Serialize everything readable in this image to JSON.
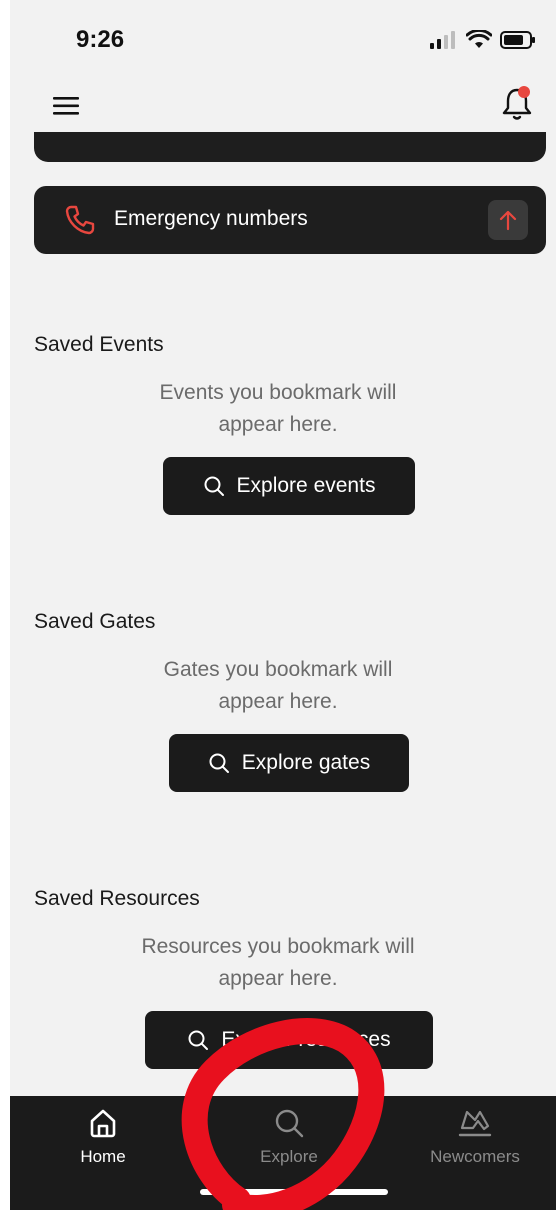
{
  "status_bar": {
    "time": "9:26"
  },
  "emergency": {
    "label": "Emergency numbers"
  },
  "sections": [
    {
      "title": "Saved Events",
      "empty_line1": "Events you bookmark will",
      "empty_line2": "appear here.",
      "button_label": "Explore events"
    },
    {
      "title": "Saved Gates",
      "empty_line1": "Gates you bookmark will",
      "empty_line2": "appear here.",
      "button_label": "Explore gates"
    },
    {
      "title": "Saved Resources",
      "empty_line1": "Resources you bookmark will",
      "empty_line2": "appear here.",
      "button_label": "Explore resources"
    }
  ],
  "tabs": [
    {
      "label": "Home",
      "icon": "home-icon",
      "active": true
    },
    {
      "label": "Explore",
      "icon": "search-icon",
      "active": false
    },
    {
      "label": "Newcomers",
      "icon": "newcomers-icon",
      "active": false
    }
  ],
  "colors": {
    "accent_red": "#e8473f",
    "annotation_red": "#e8101e",
    "card_dark": "#1e1e1e",
    "background": "#f2f2f2"
  }
}
